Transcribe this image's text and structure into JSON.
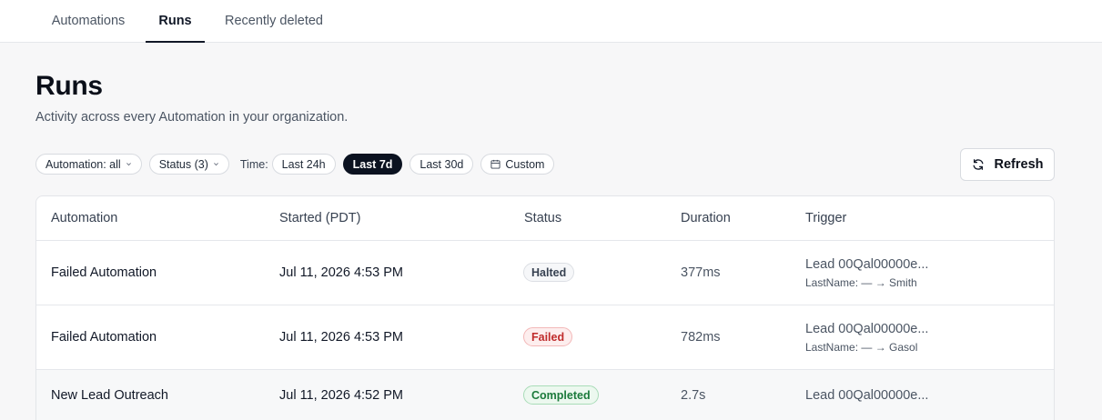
{
  "tabs": {
    "automations": "Automations",
    "runs": "Runs",
    "recently_deleted": "Recently deleted"
  },
  "page": {
    "title": "Runs",
    "subtitle": "Activity across every Automation in your organization."
  },
  "filters": {
    "automation": "Automation: all",
    "status": "Status (3)",
    "time_label": "Time:",
    "time_options": [
      "Last 24h",
      "Last 7d",
      "Last 30d",
      "Custom"
    ],
    "selected_time": "Last 7d"
  },
  "refresh_label": "Refresh",
  "table": {
    "columns": [
      "Automation",
      "Started (PDT)",
      "Status",
      "Duration",
      "Trigger"
    ],
    "rows": [
      {
        "automation": "Failed Automation",
        "started": "Jul 11, 2026 4:53 PM",
        "status": "Halted",
        "duration": "377ms",
        "trigger": "Lead 00Qal00000e...",
        "trigger_detail": "LastName: — → Smith"
      },
      {
        "automation": "Failed Automation",
        "started": "Jul 11, 2026 4:53 PM",
        "status": "Failed",
        "duration": "782ms",
        "trigger": "Lead 00Qal00000e...",
        "trigger_detail": "LastName: — → Gasol"
      },
      {
        "automation": "New Lead Outreach",
        "started": "Jul 11, 2026 4:52 PM",
        "status": "Completed",
        "duration": "2.7s",
        "trigger": "Lead 00Qal00000e..."
      }
    ]
  },
  "colors": {
    "selected_chip": "#0b1220",
    "failed_text": "#c02c2c",
    "completed_text": "#1b7a3b"
  }
}
